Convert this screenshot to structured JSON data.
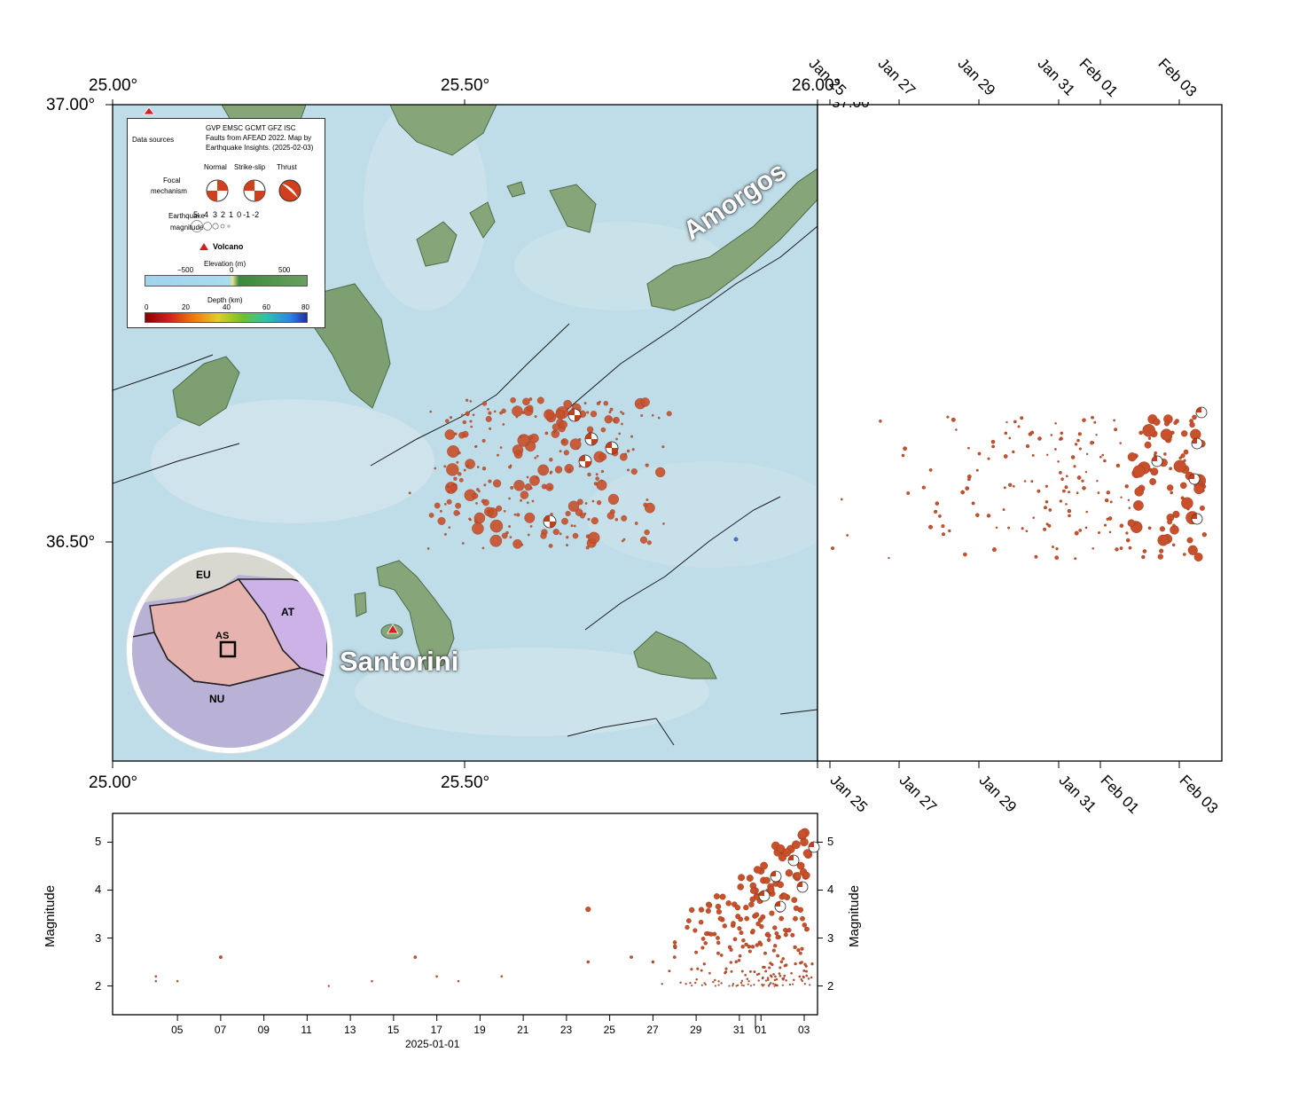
{
  "map": {
    "lon_ticks_top": [
      "25.00°",
      "25.50°",
      "26.00°"
    ],
    "lon_ticks_bottom": [
      "25.00°",
      "25.50°"
    ],
    "lat_ticks": [
      "37.00°",
      "36.50°"
    ],
    "lat_tick_right_partial": "37.00°",
    "lon_range": [
      25.0,
      26.0
    ],
    "lat_range": [
      36.25,
      37.0
    ],
    "place_labels": [
      "Amorgos",
      "Santorini"
    ],
    "colors": {
      "sea": "#bfdde8",
      "land": "#7a9a70",
      "quake": "#c8502a",
      "fault": "#1a1a1a",
      "volcano": "#d62020"
    }
  },
  "legend": {
    "data_sources_label": "Data sources",
    "data_sources_text_1": "GVP EMSC GCMT GFZ ISC",
    "data_sources_text_2": "Faults from AFEAD 2022.  Map by",
    "data_sources_text_3": "Earthquake Insights. (2025-02-03)",
    "focal_label_1": "Focal",
    "focal_label_2": "mechanism",
    "focal_types": [
      "Normal",
      "Strike-slip",
      "Thrust"
    ],
    "magnitude_label_1": "Earthquake",
    "magnitude_label_2": "magnitude",
    "magnitude_values": [
      "5",
      "4",
      "3",
      "2",
      "1",
      "0",
      "-1",
      "-2"
    ],
    "volcano_label": "Volcano",
    "elevation_label": "Elevation (m)",
    "elevation_ticks": [
      "−500",
      "0",
      "500"
    ],
    "depth_label": "Depth (km)",
    "depth_ticks": [
      "0",
      "20",
      "40",
      "60",
      "80"
    ]
  },
  "inset": {
    "plate_labels": [
      "EU",
      "AT",
      "AS",
      "NU"
    ]
  },
  "time_axis": {
    "date_labels": [
      "Jan 25",
      "Jan 27",
      "Jan 29",
      "Jan 31",
      "Feb 01",
      "Feb 03"
    ]
  },
  "magnitude_panel": {
    "ylabel_left": "Magnitude",
    "ylabel_right": "Magnitude",
    "y_ticks": [
      "2",
      "3",
      "4",
      "5"
    ],
    "x_ticks": [
      "05",
      "07",
      "09",
      "11",
      "13",
      "15",
      "17",
      "19",
      "21",
      "23",
      "25",
      "27",
      "29",
      "31",
      "01",
      "03"
    ],
    "x_sublabel": "2025-01-01"
  },
  "chart_data": {
    "type": "scatter",
    "title": "",
    "xlabel": "",
    "ylabel": "Magnitude",
    "ylim": [
      1.4,
      5.6
    ],
    "series": [
      {
        "x": [
          "2025-01-04",
          "2025-01-04",
          "2025-01-05",
          "2025-01-07",
          "2025-01-07",
          "2025-01-12",
          "2025-01-14",
          "2025-01-16",
          "2025-01-17",
          "2025-01-18",
          "2025-01-20",
          "2025-01-24",
          "2025-01-24",
          "2025-01-26",
          "2025-01-27",
          "2025-01-28",
          "2025-01-29",
          "2025-01-30",
          "2025-01-31",
          "2025-02-01",
          "2025-02-02",
          "2025-02-03"
        ],
        "y": [
          2.1,
          2.2,
          2.1,
          2.6,
          2.6,
          2.0,
          2.1,
          2.6,
          2.2,
          2.1,
          2.2,
          3.6,
          2.5,
          2.6,
          2.5,
          2.6,
          2.7,
          3.0,
          3.2,
          4.4,
          4.8,
          5.0
        ]
      }
    ]
  }
}
